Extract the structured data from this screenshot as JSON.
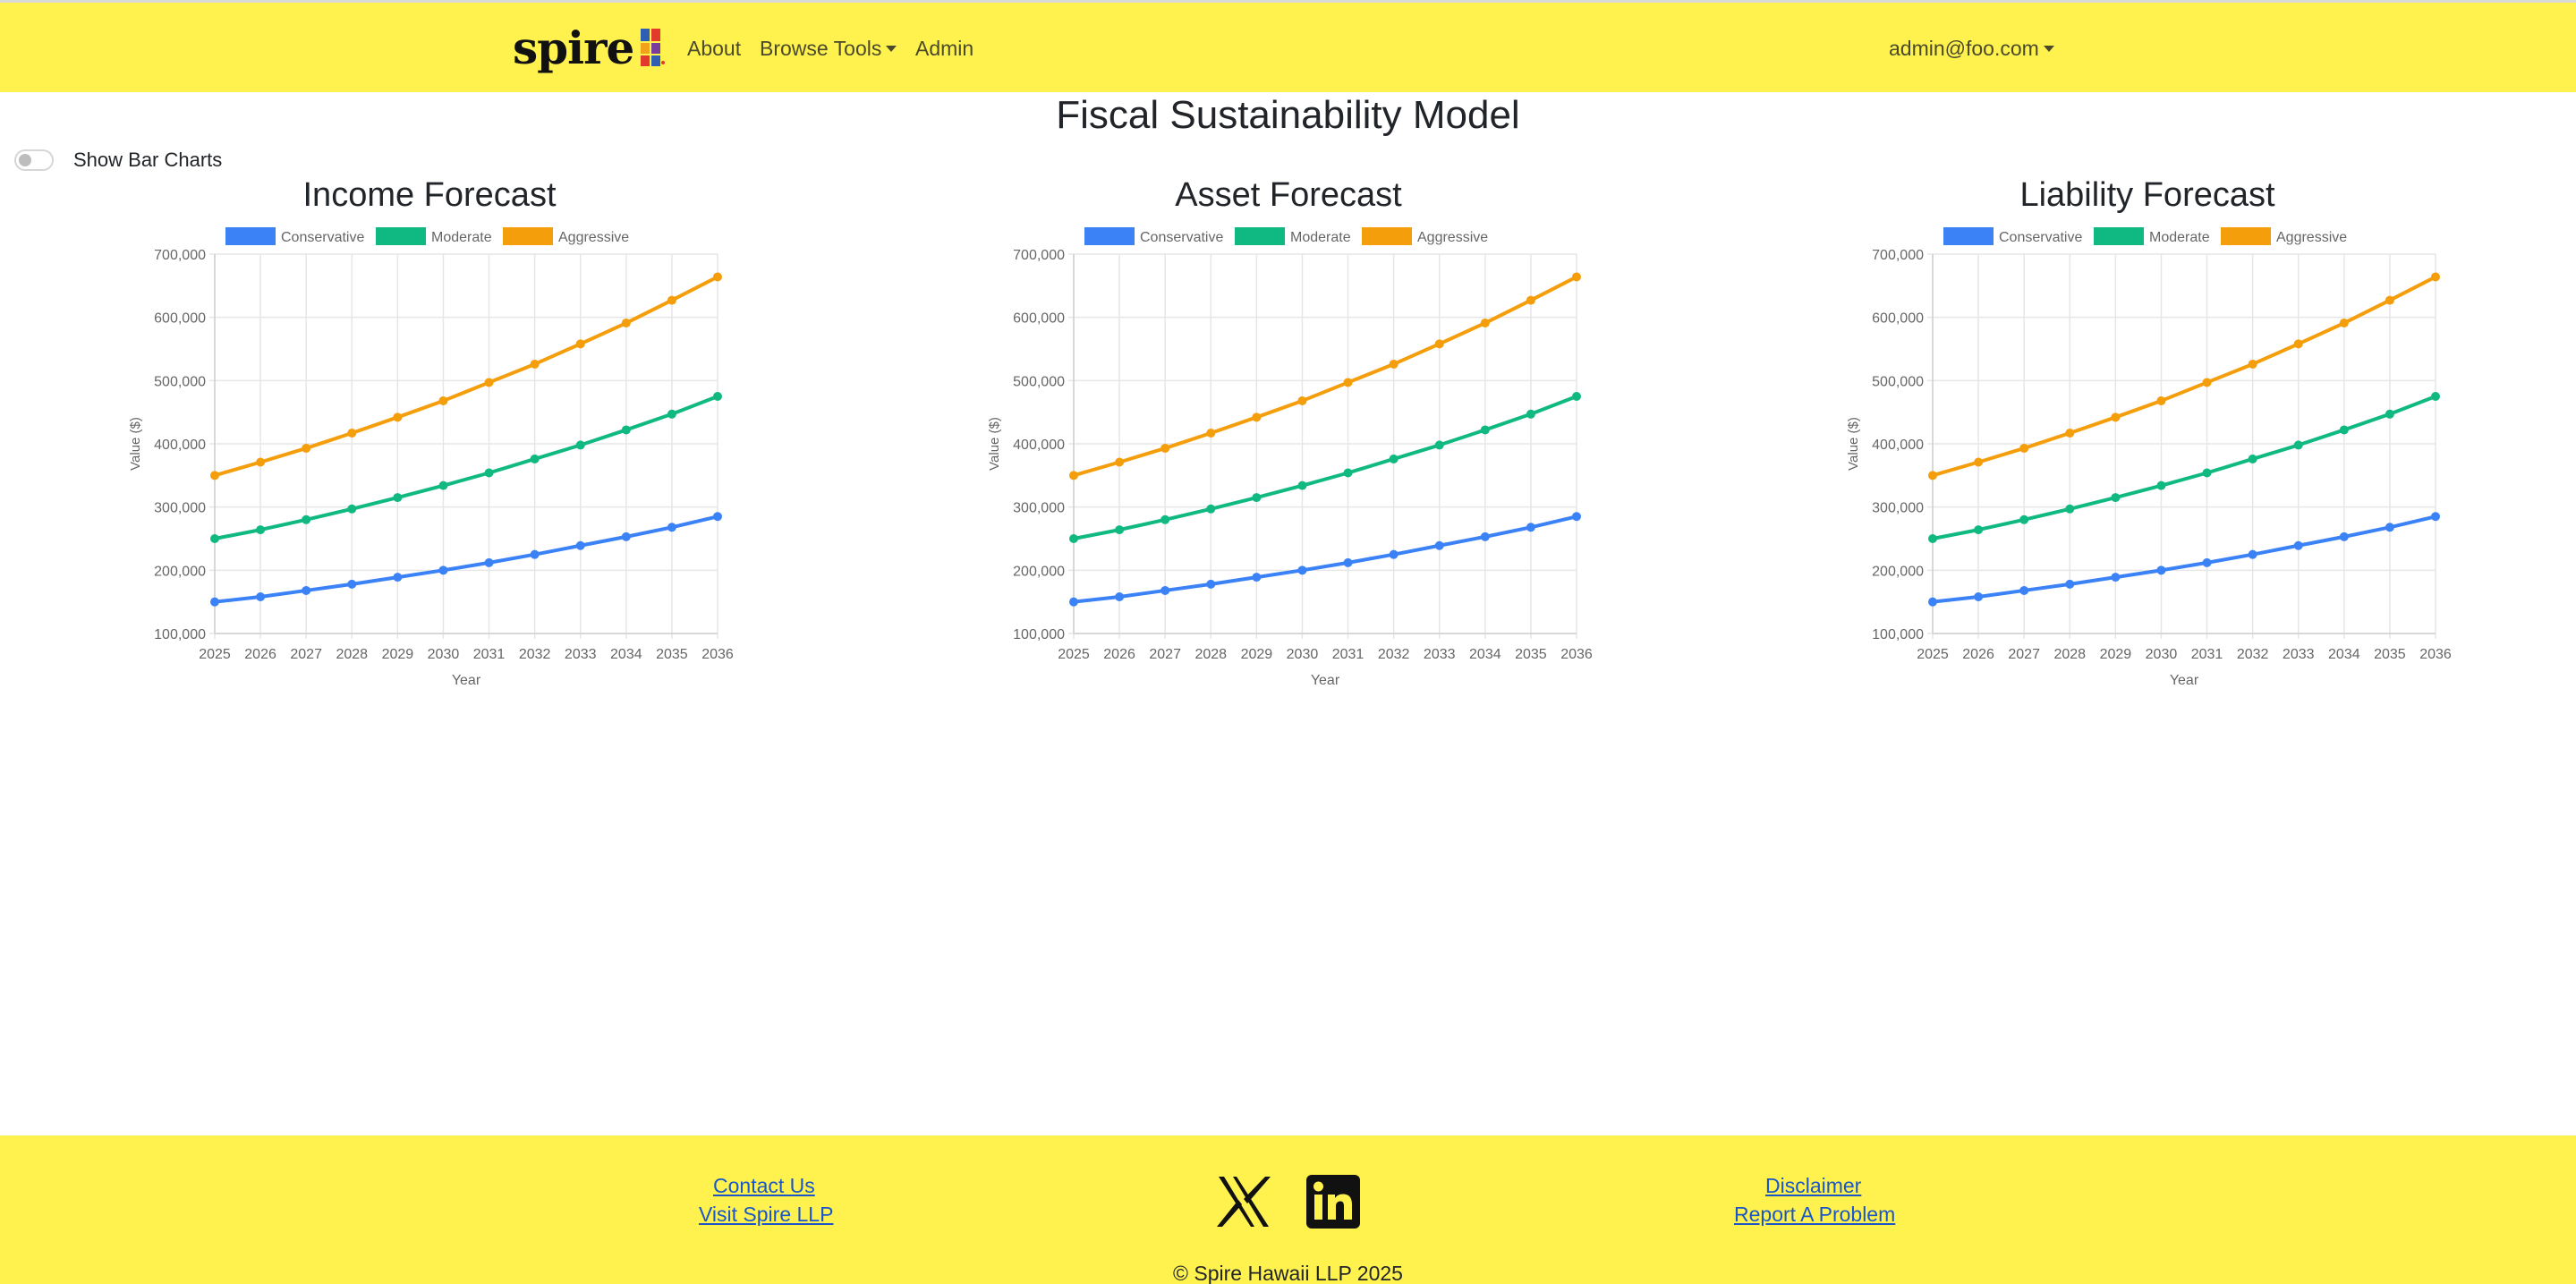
{
  "brand": {
    "name": "spire"
  },
  "nav": {
    "about": "About",
    "browse_tools": "Browse Tools",
    "admin": "Admin",
    "user": "admin@foo.com"
  },
  "page": {
    "title": "Fiscal Sustainability Model",
    "toggle_label": "Show Bar Charts",
    "toggle_on": false
  },
  "colors": {
    "header_bg": "#fff24f",
    "conservative": "#3b82f6",
    "moderate": "#10b981",
    "aggressive": "#f59e0b"
  },
  "chart_data": [
    {
      "type": "line",
      "title": "Income Forecast",
      "xlabel": "Year",
      "ylabel": "Value ($)",
      "ylim": [
        100000,
        700000
      ],
      "yticks": [
        "100,000",
        "200,000",
        "300,000",
        "400,000",
        "500,000",
        "600,000",
        "700,000"
      ],
      "x": [
        "2025",
        "2026",
        "2027",
        "2028",
        "2029",
        "2030",
        "2031",
        "2032",
        "2033",
        "2034",
        "2035",
        "2036"
      ],
      "grid": true,
      "legend": "top",
      "series": [
        {
          "name": "Conservative",
          "color": "#3b82f6",
          "values": [
            150000,
            158000,
            168000,
            178000,
            189000,
            200000,
            212000,
            225000,
            239000,
            253000,
            268000,
            285000
          ]
        },
        {
          "name": "Moderate",
          "color": "#10b981",
          "values": [
            250000,
            264000,
            280000,
            297000,
            315000,
            334000,
            354000,
            376000,
            398000,
            422000,
            447000,
            475000
          ]
        },
        {
          "name": "Aggressive",
          "color": "#f59e0b",
          "values": [
            350000,
            371000,
            393000,
            417000,
            442000,
            468000,
            497000,
            526000,
            558000,
            591000,
            627000,
            664000
          ]
        }
      ]
    },
    {
      "type": "line",
      "title": "Asset Forecast",
      "xlabel": "Year",
      "ylabel": "Value ($)",
      "ylim": [
        100000,
        700000
      ],
      "yticks": [
        "100,000",
        "200,000",
        "300,000",
        "400,000",
        "500,000",
        "600,000",
        "700,000"
      ],
      "x": [
        "2025",
        "2026",
        "2027",
        "2028",
        "2029",
        "2030",
        "2031",
        "2032",
        "2033",
        "2034",
        "2035",
        "2036"
      ],
      "grid": true,
      "legend": "top",
      "series": [
        {
          "name": "Conservative",
          "color": "#3b82f6",
          "values": [
            150000,
            158000,
            168000,
            178000,
            189000,
            200000,
            212000,
            225000,
            239000,
            253000,
            268000,
            285000
          ]
        },
        {
          "name": "Moderate",
          "color": "#10b981",
          "values": [
            250000,
            264000,
            280000,
            297000,
            315000,
            334000,
            354000,
            376000,
            398000,
            422000,
            447000,
            475000
          ]
        },
        {
          "name": "Aggressive",
          "color": "#f59e0b",
          "values": [
            350000,
            371000,
            393000,
            417000,
            442000,
            468000,
            497000,
            526000,
            558000,
            591000,
            627000,
            664000
          ]
        }
      ]
    },
    {
      "type": "line",
      "title": "Liability Forecast",
      "xlabel": "Year",
      "ylabel": "Value ($)",
      "ylim": [
        100000,
        700000
      ],
      "yticks": [
        "100,000",
        "200,000",
        "300,000",
        "400,000",
        "500,000",
        "600,000",
        "700,000"
      ],
      "x": [
        "2025",
        "2026",
        "2027",
        "2028",
        "2029",
        "2030",
        "2031",
        "2032",
        "2033",
        "2034",
        "2035",
        "2036"
      ],
      "grid": true,
      "legend": "top",
      "series": [
        {
          "name": "Conservative",
          "color": "#3b82f6",
          "values": [
            150000,
            158000,
            168000,
            178000,
            189000,
            200000,
            212000,
            225000,
            239000,
            253000,
            268000,
            285000
          ]
        },
        {
          "name": "Moderate",
          "color": "#10b981",
          "values": [
            250000,
            264000,
            280000,
            297000,
            315000,
            334000,
            354000,
            376000,
            398000,
            422000,
            447000,
            475000
          ]
        },
        {
          "name": "Aggressive",
          "color": "#f59e0b",
          "values": [
            350000,
            371000,
            393000,
            417000,
            442000,
            468000,
            497000,
            526000,
            558000,
            591000,
            627000,
            664000
          ]
        }
      ]
    }
  ],
  "footer": {
    "contact": "Contact Us",
    "visit": "Visit Spire LLP",
    "disclaimer": "Disclaimer",
    "report": "Report A Problem",
    "social_icons": [
      "x-icon",
      "linkedin-icon"
    ],
    "copyright": "© Spire Hawaii LLP 2025"
  }
}
